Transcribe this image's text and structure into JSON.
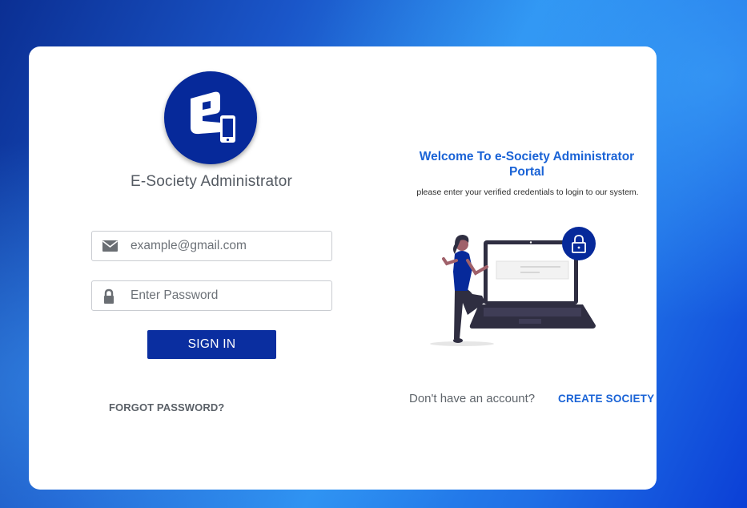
{
  "app": {
    "title": "E-Society Administrator",
    "logo_icon": "e-society-logo-icon"
  },
  "login": {
    "email_placeholder": "example@gmail.com",
    "email_icon": "envelope-icon",
    "password_placeholder": "Enter Password",
    "password_icon": "lock-icon",
    "signin_label": "SIGN IN",
    "forgot_label": "FORGOT PASSWORD?"
  },
  "welcome": {
    "heading": "Welcome To e-Society Administrator Portal",
    "subtitle": "please enter your verified credentials to login to our system.",
    "illustration": "woman-with-laptop-lock-illustration"
  },
  "signup": {
    "prompt": "Don't have an account?",
    "create_label": "CREATE SOCIETY"
  },
  "colors": {
    "primary": "#0a2ea0",
    "link": "#1a63d6",
    "background": "#1f6fe6",
    "card": "#ffffff"
  }
}
